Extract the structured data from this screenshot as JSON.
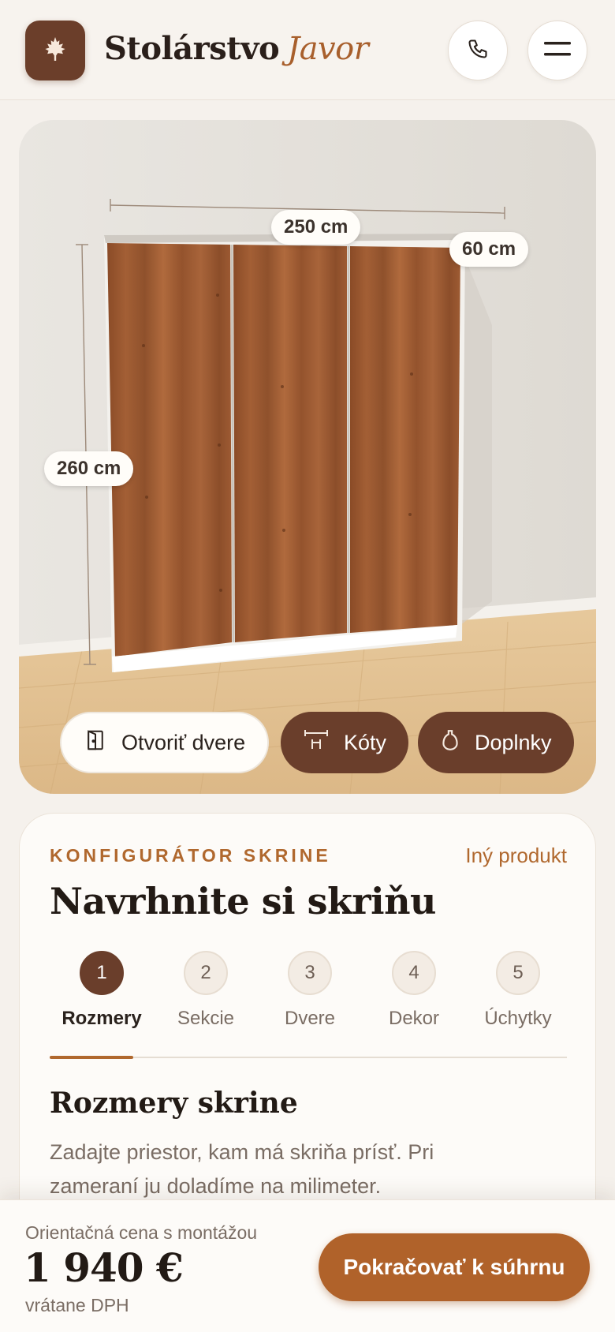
{
  "header": {
    "brand_main": "Stolárstvo",
    "brand_accent": "Javor",
    "logo_icon": "maple-leaf-icon",
    "phone_icon": "phone-icon",
    "menu_icon": "hamburger-menu-icon"
  },
  "preview": {
    "dimensions": {
      "width": "250 cm",
      "depth": "60 cm",
      "height": "260 cm"
    },
    "actions": [
      {
        "label": "Otvoriť dvere",
        "icon": "door-icon"
      },
      {
        "label": "Kóty",
        "icon": "ruler-icon"
      },
      {
        "label": "Doplnky",
        "icon": "vase-icon"
      }
    ]
  },
  "configurator": {
    "eyebrow": "KONFIGURÁTOR SKRINE",
    "other_product": "Iný produkt",
    "title": "Navrhnite si skriňu",
    "steps": [
      {
        "number": "1",
        "label": "Rozmery",
        "active": true
      },
      {
        "number": "2",
        "label": "Sekcie",
        "active": false
      },
      {
        "number": "3",
        "label": "Dvere",
        "active": false
      },
      {
        "number": "4",
        "label": "Dekor",
        "active": false
      },
      {
        "number": "5",
        "label": "Úchytky",
        "active": false
      }
    ],
    "section_title": "Rozmery skrine",
    "section_desc": "Zadajte priestor, kam má skriňa prísť. Pri zameraní ju doladíme na milimeter."
  },
  "footer": {
    "price_caption": "Orientačná cena s montážou",
    "price": "1 940 €",
    "price_note": "vrátane DPH",
    "cta_label": "Pokračovať k súhrnu"
  },
  "colors": {
    "accent": "#b0622a",
    "brand_dark": "#6a3e2b",
    "background": "#f5f1ec"
  }
}
